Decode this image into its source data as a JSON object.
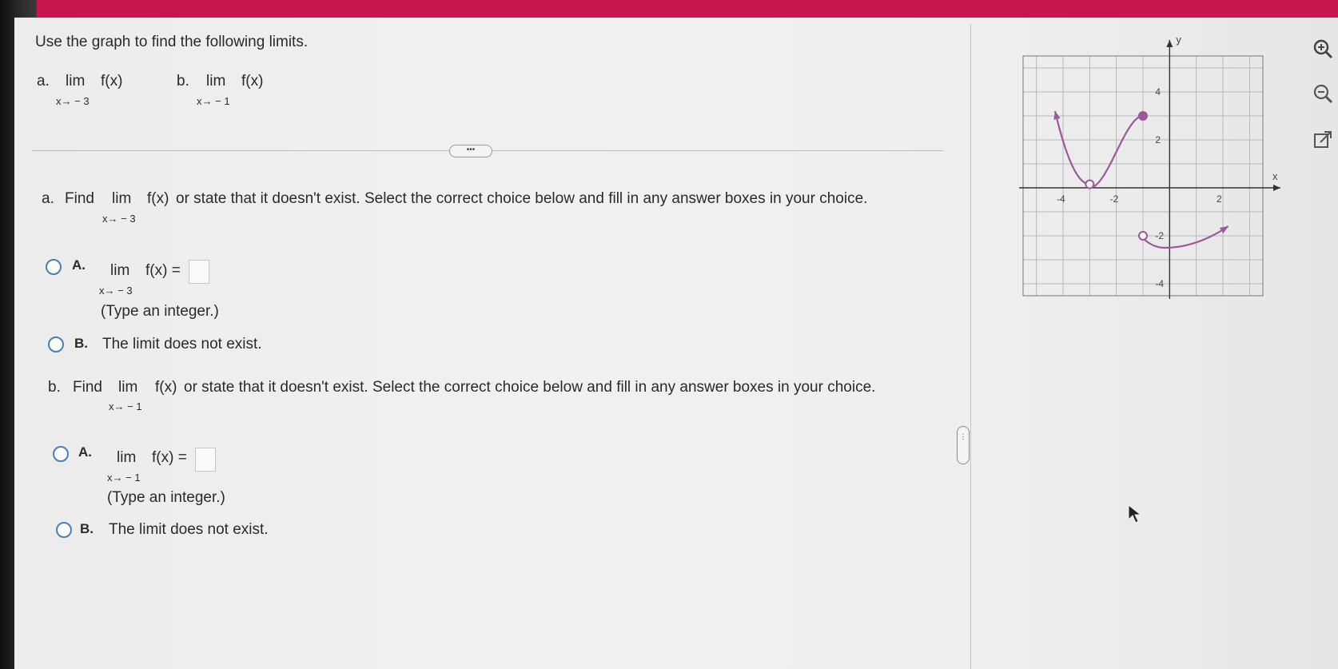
{
  "prompt": "Use the graph to find the following limits.",
  "header_parts": [
    {
      "letter": "a.",
      "lim": "lim",
      "func": "f(x)",
      "approach": "x→ − 3"
    },
    {
      "letter": "b.",
      "lim": "lim",
      "func": "f(x)",
      "approach": "x→ − 1"
    }
  ],
  "divider_handle": "•••",
  "side_handle": "•\n•\n•\n•",
  "questions": [
    {
      "letter": "a.",
      "find": "Find",
      "lim": "lim",
      "func": "f(x)",
      "approach": "x→ − 3",
      "rest": "or state that it doesn't exist. Select the correct choice below and fill in any answer boxes in your choice.",
      "optA": {
        "label": "A.",
        "lim": "lim",
        "expr": "f(x) =",
        "approach": "x→ − 3",
        "hint": "(Type an integer.)"
      },
      "optB": {
        "label": "B.",
        "text": "The limit does not exist."
      }
    },
    {
      "letter": "b.",
      "find": "Find",
      "lim": "lim",
      "func": "f(x)",
      "approach": "x→ − 1",
      "rest": "or state that it doesn't exist. Select the correct choice below and fill in any answer boxes in your choice.",
      "optA": {
        "label": "A.",
        "lim": "lim",
        "expr": "f(x) =",
        "approach": "x→ − 1",
        "hint": "(Type an integer.)"
      },
      "optB": {
        "label": "B.",
        "text": "The limit does not exist."
      }
    }
  ],
  "graph": {
    "x_axis_label": "x",
    "y_axis_label": "y",
    "x_ticks": [
      "-4",
      "-2",
      "2"
    ],
    "y_ticks": [
      "4",
      "2",
      "-2",
      "-4"
    ],
    "curve_color": "#9a5a9a",
    "points": {
      "open_left": [
        -3,
        0
      ],
      "closed_top": [
        -1,
        3
      ],
      "open_bottom": [
        -1,
        -2
      ]
    }
  },
  "tools": [
    "zoom-in-icon",
    "zoom-out-icon",
    "external-link-icon"
  ],
  "accent": "#c8174f",
  "radio_color": "#4a7fb5"
}
